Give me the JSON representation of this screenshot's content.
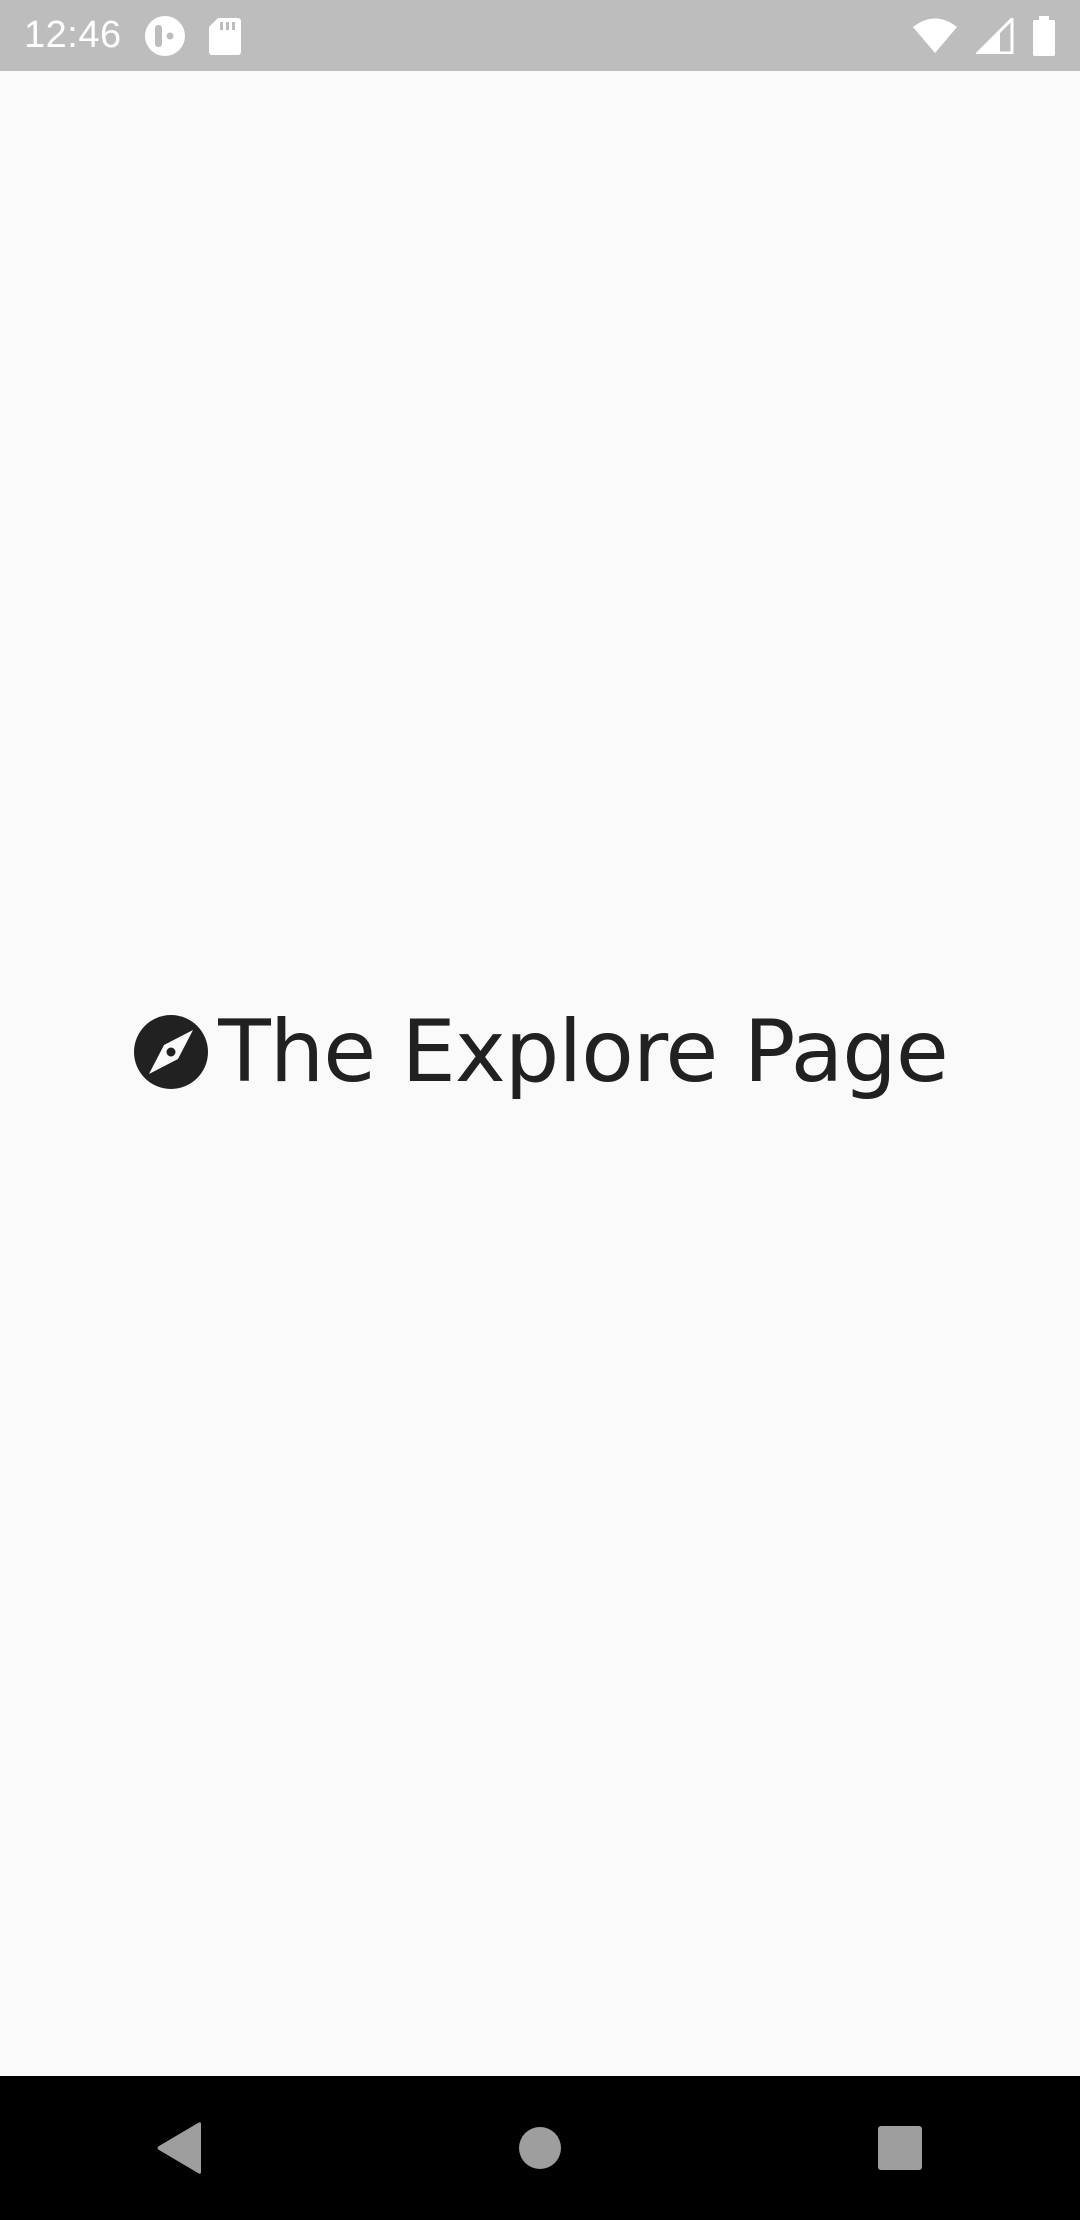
{
  "status_bar": {
    "time": "12:46",
    "left_icons": [
      "app-notification-icon",
      "sd-card-icon"
    ],
    "right_icons": [
      "wifi-icon",
      "cell-signal-icon",
      "battery-icon"
    ],
    "background": "#bdbdbd"
  },
  "main": {
    "title": "The Explore Page",
    "title_icon": "compass-icon",
    "text_color": "#212121",
    "background": "#fafafa"
  },
  "nav_bar": {
    "buttons": [
      "back-icon",
      "home-icon",
      "recents-icon"
    ],
    "icon_color": "#9e9e9e",
    "background": "#000000"
  }
}
